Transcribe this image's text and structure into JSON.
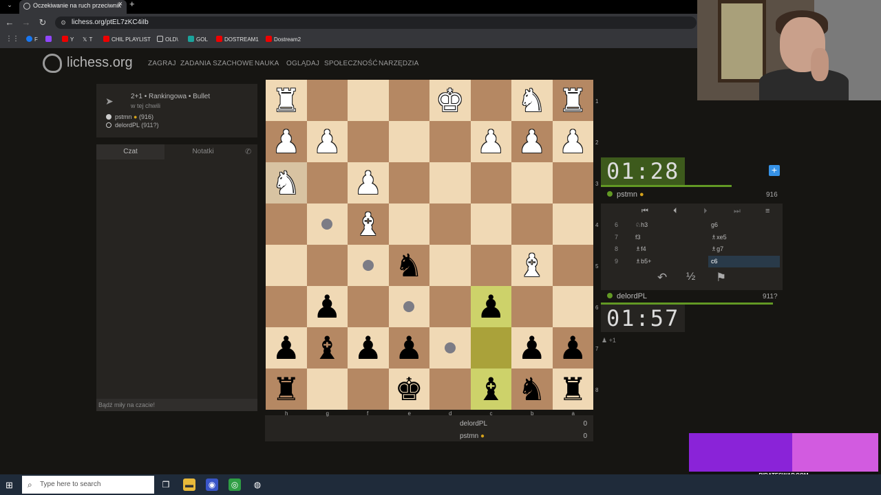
{
  "browser": {
    "tab_title": "Oczekiwanie na ruch przeciwnik",
    "url": "lichess.org/ptEL7zKC4iIb",
    "bookmarks": [
      "F",
      "",
      "Y",
      "T",
      "CHIL PLAYLIST",
      "OLD\\",
      "GOL",
      "DOSTREAM1",
      "Dostream2"
    ]
  },
  "site": {
    "logo_text": "lichess.org",
    "nav": [
      "ZAGRAJ",
      "ZADANIA SZACHOWE",
      "NAUKA",
      "OGLĄDAJ",
      "SPOŁECZNOŚĆ",
      "NARZĘDZIA"
    ]
  },
  "game_info": {
    "type": "2+1 • Rankingowa • Bullet",
    "time": "w tej chwili",
    "white_player": "pstmn",
    "white_rating": "(916)",
    "black_player": "delordPL",
    "black_rating": "(911?)"
  },
  "chat": {
    "tab_chat": "Czat",
    "tab_notes": "Notatki",
    "placeholder": "Bądź miły na czacie!"
  },
  "board": {
    "ranks": [
      "1",
      "2",
      "3",
      "4",
      "5",
      "6",
      "7",
      "8"
    ],
    "files": [
      "h",
      "g",
      "f",
      "e",
      "d",
      "c",
      "b",
      "a"
    ],
    "pieces": [
      [
        "♜w",
        "",
        "",
        "",
        "♚w",
        "",
        "♞w",
        "♜w"
      ],
      [
        "♟w",
        "♟w",
        "",
        "",
        "",
        "♟w",
        "♟w",
        "♟w"
      ],
      [
        "♞w",
        "",
        "♟w",
        "",
        "",
        "",
        "",
        ""
      ],
      [
        "",
        "",
        "♝w",
        "",
        "",
        "",
        "",
        ""
      ],
      [
        "",
        "",
        "",
        "♞b",
        "",
        "",
        "♝w",
        ""
      ],
      [
        "",
        "♟b",
        "",
        "",
        "",
        "♟b",
        "",
        ""
      ],
      [
        "♟b",
        "♝b",
        "♟b",
        "♟b",
        "",
        "",
        "♟b",
        "♟b"
      ],
      [
        "♜b",
        "",
        "",
        "♚b",
        "",
        "♝b",
        "♞b",
        "♜b"
      ]
    ]
  },
  "scores": [
    {
      "name": "delordPL",
      "value": "0"
    },
    {
      "name": "pstmn",
      "value": "0"
    }
  ],
  "clocks": {
    "top": "01:28",
    "bottom": "01:57"
  },
  "players": {
    "top_name": "pstmn",
    "top_rating": "916",
    "bottom_name": "delordPL",
    "bottom_rating": "911?"
  },
  "moves": [
    {
      "num": "6",
      "white": "♘h3",
      "black": "g6"
    },
    {
      "num": "7",
      "white": "f3",
      "black": "♗xe5"
    },
    {
      "num": "8",
      "white": "♗f4",
      "black": "♗g7"
    },
    {
      "num": "9",
      "white": "♗b5+",
      "black": "c6"
    }
  ],
  "spectators": "+1",
  "ad": {
    "text": "PIRATESWAP.COM"
  },
  "taskbar": {
    "search_placeholder": "Type here to search"
  }
}
